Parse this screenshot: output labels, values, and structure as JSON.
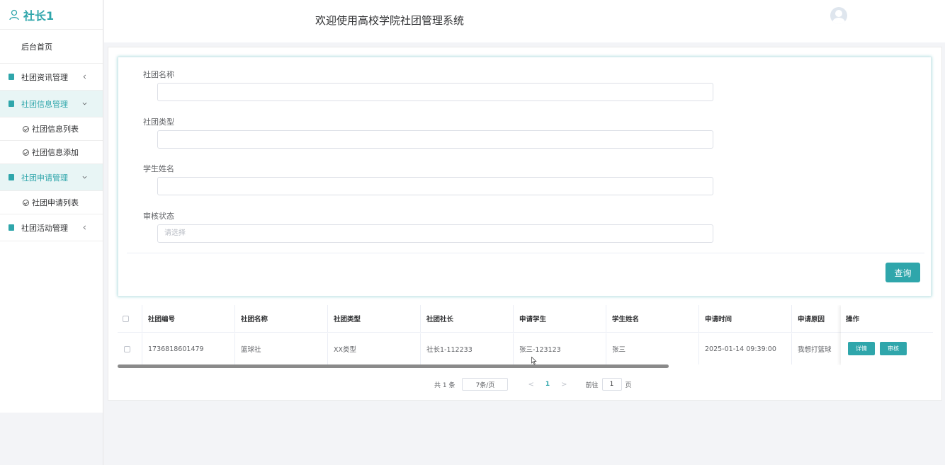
{
  "sidebar": {
    "brand": "社长1",
    "home": "后台首页",
    "groups": [
      {
        "label": "社团资讯管理",
        "expanded": false
      },
      {
        "label": "社团信息管理",
        "expanded": true,
        "children": [
          "社团信息列表",
          "社团信息添加"
        ]
      },
      {
        "label": "社团申请管理",
        "expanded": true,
        "children": [
          "社团申请列表"
        ]
      },
      {
        "label": "社团活动管理",
        "expanded": false
      }
    ]
  },
  "header": {
    "title": "欢迎使用高校学院社团管理系统"
  },
  "search": {
    "fields": [
      {
        "label": "社团名称",
        "value": "",
        "placeholder": ""
      },
      {
        "label": "社团类型",
        "value": "",
        "placeholder": ""
      },
      {
        "label": "学生姓名",
        "value": "",
        "placeholder": ""
      },
      {
        "label": "审核状态",
        "value": "",
        "placeholder": "请选择"
      }
    ],
    "query_label": "查询"
  },
  "table": {
    "columns": [
      "社团编号",
      "社团名称",
      "社团类型",
      "社团社长",
      "申请学生",
      "学生姓名",
      "申请时间",
      "申请原因"
    ],
    "action_header": "操作",
    "rows": [
      {
        "cells": [
          "1736818601479",
          "篮球社",
          "XX类型",
          "社长1-112233",
          "张三-123123",
          "张三",
          "2025-01-14 09:39:00",
          "我想打篮球"
        ],
        "actions": [
          "详情",
          "审核"
        ]
      }
    ]
  },
  "pagination": {
    "total": "共 1 条",
    "page_size": "7条/页",
    "prev": "<",
    "current_page": "1",
    "next": ">",
    "goto_label": "前往",
    "goto_value": "1",
    "page_suffix": "页"
  },
  "colors": {
    "accent": "#2fa6ab",
    "active_bg": "#e8f5f5"
  }
}
